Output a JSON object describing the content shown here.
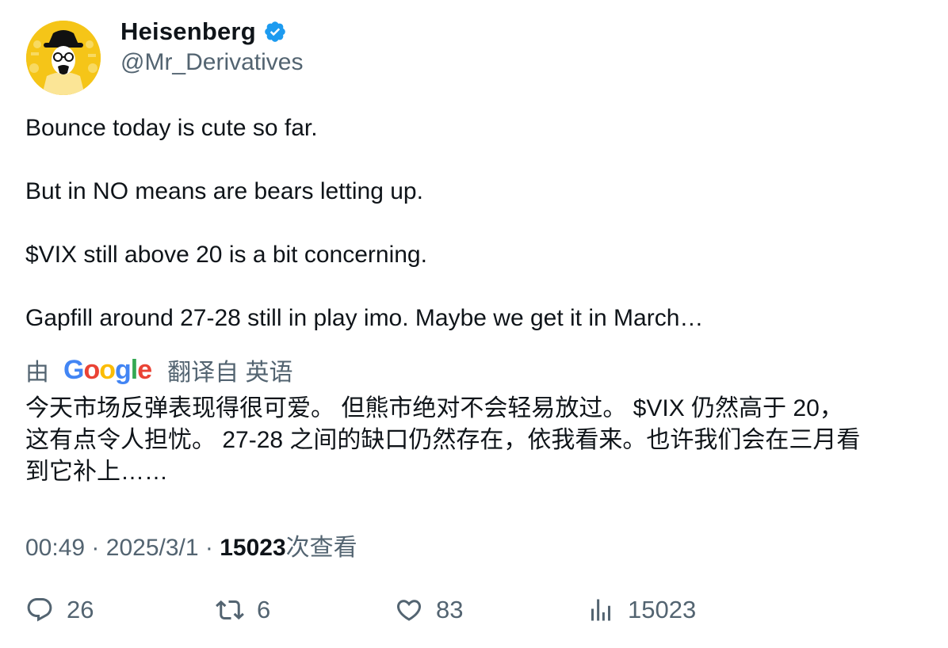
{
  "author": {
    "display_name": "Heisenberg",
    "handle": "@Mr_Derivatives",
    "verified_icon": "verified-badge-icon",
    "avatar_icon": "heisenberg-avatar-icon",
    "verified_color": "#1d9bf0"
  },
  "tweet": {
    "lines": [
      "Bounce today is cute so far.",
      "But in NO means are bears letting up.",
      "$VIX still above 20 is a bit concerning.",
      "Gapfill around 27-28 still in play imo. Maybe we get it in March…"
    ]
  },
  "translation": {
    "by_label": "由",
    "provider_parts": [
      "G",
      "o",
      "o",
      "g",
      "l",
      "e"
    ],
    "from_label": "翻译自 英语",
    "lines": [
      "今天市场反弹表现得很可爱。 但熊市绝对不会轻易放过。 $VIX 仍然高于 20，",
      "这有点令人担忧。 27-28 之间的缺口仍然存在，依我看来。也许我们会在三月看",
      "到它补上……"
    ]
  },
  "meta": {
    "time": "00:49",
    "separator": "·",
    "date": "2025/3/1",
    "views_count": "15023",
    "views_label": "次查看"
  },
  "actions": {
    "replies": "26",
    "retweets": "6",
    "likes": "83",
    "views": "15023"
  },
  "colors": {
    "text": "#0f1419",
    "secondary": "#536471",
    "avatar_bg": "#f5c518"
  }
}
